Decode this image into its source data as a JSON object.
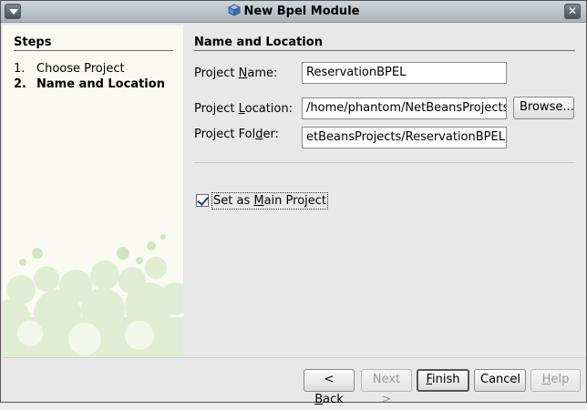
{
  "window": {
    "title": "New Bpel Module",
    "close_glyph": "✕"
  },
  "steps": {
    "heading": "Steps",
    "items": [
      {
        "num": "1.",
        "label": "Choose Project"
      },
      {
        "num": "2.",
        "label": "Name and Location"
      }
    ]
  },
  "section": {
    "title": "Name and Location"
  },
  "form": {
    "project_name": {
      "label_pre": "Project ",
      "label_mn": "N",
      "label_post": "ame:",
      "value": "ReservationBPEL"
    },
    "project_location": {
      "label_pre": "Project ",
      "label_mn": "L",
      "label_post": "ocation:",
      "value": "/home/phantom/NetBeansProjects"
    },
    "project_folder": {
      "label_pre": "Project Fol",
      "label_mn": "d",
      "label_post": "er:",
      "value": "etBeansProjects/ReservationBPEL"
    },
    "browse_button": "Browse...",
    "main_project": {
      "label_pre": "Set as ",
      "label_mn": "M",
      "label_post": "ain Project",
      "checked": true
    }
  },
  "buttons": {
    "back": {
      "pre": "< ",
      "mn": "B",
      "post": "ack"
    },
    "next": "Next >",
    "finish": {
      "pre": "",
      "mn": "F",
      "post": "inish"
    },
    "cancel": "Cancel",
    "help": {
      "pre": "",
      "mn": "H",
      "post": "elp"
    }
  },
  "icons": {
    "window_menu": "triangle-down-icon",
    "title": "cube-icon",
    "close": "close-icon",
    "check": "checkmark-icon"
  }
}
